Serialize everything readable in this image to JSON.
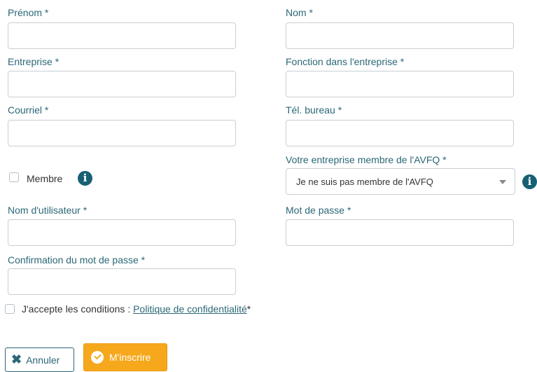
{
  "fields": {
    "first_name_label": "Prénom *",
    "last_name_label": "Nom *",
    "company_label": "Entreprise *",
    "job_title_label": "Fonction dans l'entreprise *",
    "email_label": "Courriel *",
    "office_phone_label": "Tél. bureau *",
    "avfq_member_label": "Votre entreprise membre de l'AVFQ *",
    "member_checkbox_label": "Membre",
    "username_label": "Nom d'utilisateur *",
    "password_label": "Mot de passe *",
    "password_confirm_label": "Confirmation du mot de passe *"
  },
  "avfq_select": {
    "selected": "Je ne suis pas membre de l'AVFQ"
  },
  "terms": {
    "text": "J'accepte les conditions : ",
    "link": "Politique de confidentialité",
    "suffix": "*"
  },
  "buttons": {
    "cancel": "Annuler",
    "submit": "M'inscrire"
  },
  "icons": {
    "info": "info-icon",
    "cancel": "x-icon",
    "submit": "check-circle-icon"
  },
  "colors": {
    "label": "#2b6777",
    "info_icon": "#175f73",
    "submit_button": "#f6a81c"
  }
}
